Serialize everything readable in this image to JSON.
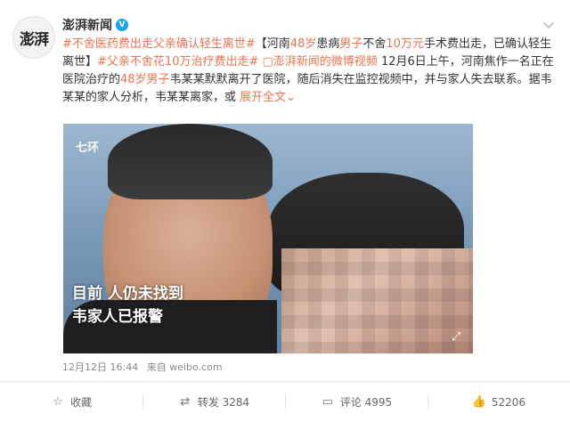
{
  "author": {
    "avatar_text": "澎湃",
    "name": "澎湃新闻",
    "verified_badge": "V"
  },
  "post": {
    "segments": [
      {
        "text": "#不舍医药费出走父亲确认轻生离世#",
        "style": "topic"
      },
      {
        "text": "【河南",
        "style": "plain"
      },
      {
        "text": "48岁",
        "style": "red"
      },
      {
        "text": "患病",
        "style": "plain"
      },
      {
        "text": "男子",
        "style": "red"
      },
      {
        "text": "不舍",
        "style": "plain"
      },
      {
        "text": "10万元",
        "style": "red"
      },
      {
        "text": "手术费出走，已确认轻生离世】",
        "style": "plain"
      },
      {
        "text": "#父亲不舍花",
        "style": "topic"
      },
      {
        "text": "10万",
        "style": "red"
      },
      {
        "text": "治疗费出走#",
        "style": "topic"
      },
      {
        "text": " ",
        "style": "plain"
      },
      {
        "text": "▢澎湃新闻的微博视频",
        "style": "link"
      },
      {
        "text": " 12月6日上午，河南焦作一名正在医院治疗的",
        "style": "plain"
      },
      {
        "text": "48岁男子",
        "style": "red"
      },
      {
        "text": "韦某某默默离开了医院，随后消失在监控视频中，并与家人失去联系。据韦某某的家人分析，韦某某离家，或 ",
        "style": "plain"
      },
      {
        "text": "展开全文",
        "style": "expand"
      }
    ],
    "expand_arrow": "⌄",
    "video": {
      "tag": "七环",
      "caption_line1": "目前 人仍未找到",
      "caption_line2": "韦家人已报警",
      "play_icon": "⤢"
    },
    "time": "12月12日 16:44",
    "source": "来自 weibo.com"
  },
  "actions": {
    "favorite": {
      "label": "收藏",
      "icon": "☆"
    },
    "repost": {
      "label": "转发 3284",
      "icon": "⇄"
    },
    "comment": {
      "label": "评论 4995",
      "icon": "▭"
    },
    "like": {
      "label": "52206",
      "icon": "👍"
    }
  },
  "colors": {
    "accent": "#eb7350",
    "text": "#333333",
    "meta": "#888888"
  }
}
